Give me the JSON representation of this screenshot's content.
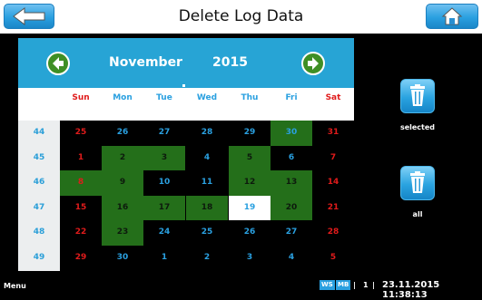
{
  "header": {
    "title": "Delete Log Data"
  },
  "calendar": {
    "month": "November",
    "year": "2015",
    "day_names": [
      "Sun",
      "Mon",
      "Tue",
      "Wed",
      "Thu",
      "Fri",
      "Sat"
    ],
    "weeks": [
      {
        "week": "44",
        "days": [
          "25",
          "26",
          "27",
          "28",
          "29",
          "30",
          "31"
        ]
      },
      {
        "week": "45",
        "days": [
          "1",
          "2",
          "3",
          "4",
          "5",
          "6",
          "7"
        ]
      },
      {
        "week": "46",
        "days": [
          "8",
          "9",
          "10",
          "11",
          "12",
          "13",
          "14"
        ]
      },
      {
        "week": "47",
        "days": [
          "15",
          "16",
          "17",
          "18",
          "19",
          "20",
          "21"
        ]
      },
      {
        "week": "48",
        "days": [
          "22",
          "23",
          "24",
          "25",
          "26",
          "27",
          "28"
        ]
      },
      {
        "week": "49",
        "days": [
          "29",
          "30",
          "1",
          "2",
          "3",
          "4",
          "5"
        ]
      }
    ],
    "logged_days": [
      [
        false,
        false,
        false,
        false,
        false,
        true,
        false
      ],
      [
        false,
        true,
        true,
        false,
        true,
        false,
        false
      ],
      [
        true,
        true,
        false,
        false,
        true,
        true,
        false
      ],
      [
        false,
        true,
        true,
        true,
        false,
        true,
        false
      ],
      [
        false,
        true,
        false,
        false,
        false,
        false,
        false
      ],
      [
        false,
        false,
        false,
        false,
        false,
        false,
        false
      ]
    ],
    "today": {
      "row": 3,
      "col": 4
    }
  },
  "buttons": {
    "selected_label": "selected",
    "all_label": "all"
  },
  "status_bar": {
    "menu_label": "Menu",
    "ws_badge": "WS",
    "mb_badge": "MB",
    "separator": "|",
    "page": "1",
    "datetime": "23.11.2015 11:38:13"
  },
  "colors": {
    "header_blue": "#27a4d5",
    "logged_green": "#246f1a",
    "weekend_red": "#e01b1b",
    "weekday_blue": "#2aa0e0",
    "weeknum_blue": "#2b9fd8",
    "today_bg": "#ffffff"
  }
}
